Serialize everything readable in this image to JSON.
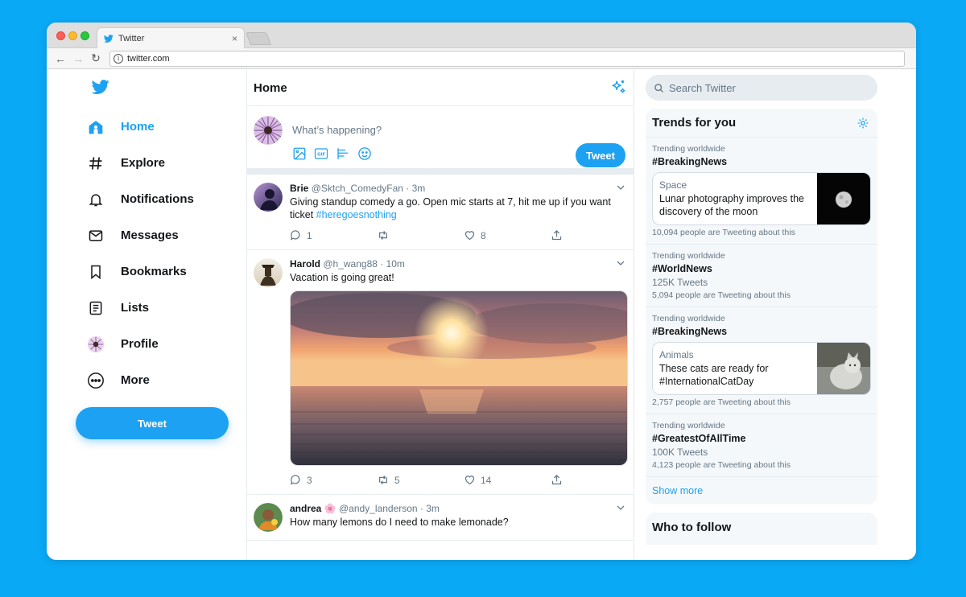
{
  "browser": {
    "tab_title": "Twitter",
    "tab_close": "×",
    "url": "twitter.com"
  },
  "sidebar": {
    "items": [
      {
        "label": "Home",
        "icon": "home-icon"
      },
      {
        "label": "Explore",
        "icon": "hashtag-icon"
      },
      {
        "label": "Notifications",
        "icon": "bell-icon"
      },
      {
        "label": "Messages",
        "icon": "envelope-icon"
      },
      {
        "label": "Bookmarks",
        "icon": "bookmark-icon"
      },
      {
        "label": "Lists",
        "icon": "list-icon"
      },
      {
        "label": "Profile",
        "icon": "avatar"
      },
      {
        "label": "More",
        "icon": "more-icon"
      }
    ],
    "tweet_button": "Tweet"
  },
  "feed": {
    "title": "Home",
    "compose": {
      "placeholder": "What’s happening?",
      "tweet_button": "Tweet"
    },
    "posts": [
      {
        "name": "Brie",
        "meta": "@Sktch_ComedyFan · 3m",
        "text": "Giving standup comedy a go. Open mic starts at 7, hit me up if you want ticket ",
        "hashtag": "#heregoesnothing",
        "replies": "1",
        "retweets": "",
        "likes": "8"
      },
      {
        "name": "Harold",
        "meta": "@h_wang88 · 10m",
        "text": "Vacation is going great!",
        "replies": "3",
        "retweets": "5",
        "likes": "14"
      },
      {
        "name": "andrea",
        "emoji": "🌸",
        "meta": "@andy_landerson · 3m",
        "text": "How many lemons do I need to make lemonade?"
      }
    ]
  },
  "right": {
    "search_placeholder": "Search Twitter",
    "trends_title": "Trends for you",
    "trends": [
      {
        "context": "Trending worldwide",
        "tag": "#BreakingNews",
        "card_category": "Space",
        "card_headline": "Lunar photography improves the discovery of the moon",
        "people": "10,094 people are Tweeting about this"
      },
      {
        "context": "Trending worldwide",
        "tag": "#WorldNews",
        "count": "125K Tweets",
        "people": "5,094 people are Tweeting about this"
      },
      {
        "context": "Trending worldwide",
        "tag": "#BreakingNews",
        "card_category": "Animals",
        "card_headline": "These cats are ready for #InternationalCatDay",
        "people": "2,757 people are Tweeting about this"
      },
      {
        "context": "Trending worldwide",
        "tag": "#GreatestOfAllTime",
        "count": "100K Tweets",
        "people": "4,123 people are Tweeting about this"
      }
    ],
    "show_more": "Show more",
    "who_to_follow": "Who to follow"
  },
  "colors": {
    "accent": "#1da1f2",
    "background": "#0aa9f6"
  }
}
